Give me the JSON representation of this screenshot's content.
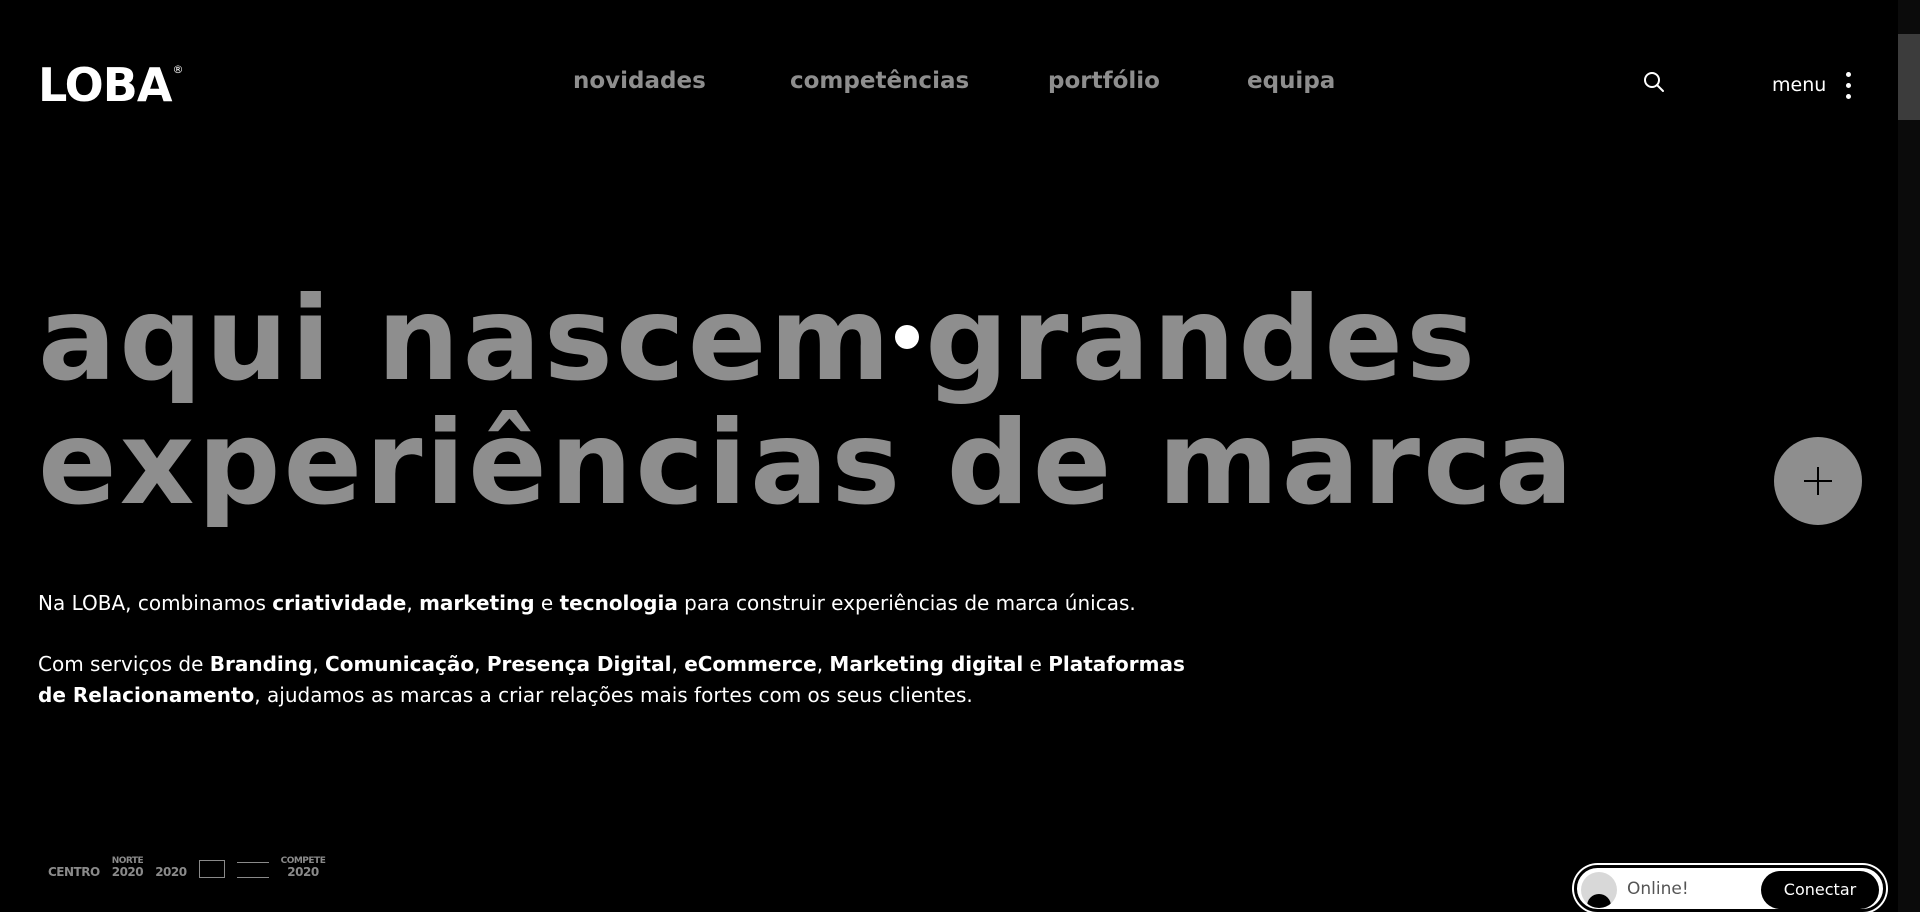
{
  "header": {
    "logo": "LOBA",
    "logo_reg": "®",
    "nav": [
      {
        "label": "novidades"
      },
      {
        "label": "competências"
      },
      {
        "label": "portfólio"
      },
      {
        "label": "equipa"
      }
    ],
    "menu_label": "menu",
    "search_icon": "search-icon"
  },
  "hero": {
    "line1_a": "aqui nascem",
    "line1_b": "grandes",
    "line2": "experiências de marca"
  },
  "intro": {
    "p1": {
      "t1": "Na LOBA, combinamos ",
      "b1": "criatividade",
      "t2": ", ",
      "b2": "marketing",
      "t3": " e ",
      "b3": "tecnologia",
      "t4": " para construir experiências de marca únicas."
    },
    "p2": {
      "t1": "Com serviços de ",
      "b1": "Branding",
      "t2": ", ",
      "b2": "Comunicação",
      "t3": ", ",
      "b3": "Presença Digital",
      "t4": ", ",
      "b4": "eCommerce",
      "t5": ", ",
      "b5": "Marketing digital",
      "t6": " e ",
      "b6": "Plataformas de Relacionamento",
      "t7": ", ajudamos as marcas a criar relações mais fortes com os seus clientes."
    }
  },
  "partners": {
    "centro": "CENTRO",
    "norte_top": "NORTE",
    "norte_bottom": "2020",
    "p2020": "2020",
    "compete_top": "COMPETE",
    "compete_bottom": "2020"
  },
  "chat": {
    "status": "Online!",
    "button": "Conectar"
  },
  "colors": {
    "background": "#000000",
    "hero_text": "#8e8e8e",
    "nav_text": "#8e8e8e",
    "body_text": "#ffffff"
  }
}
